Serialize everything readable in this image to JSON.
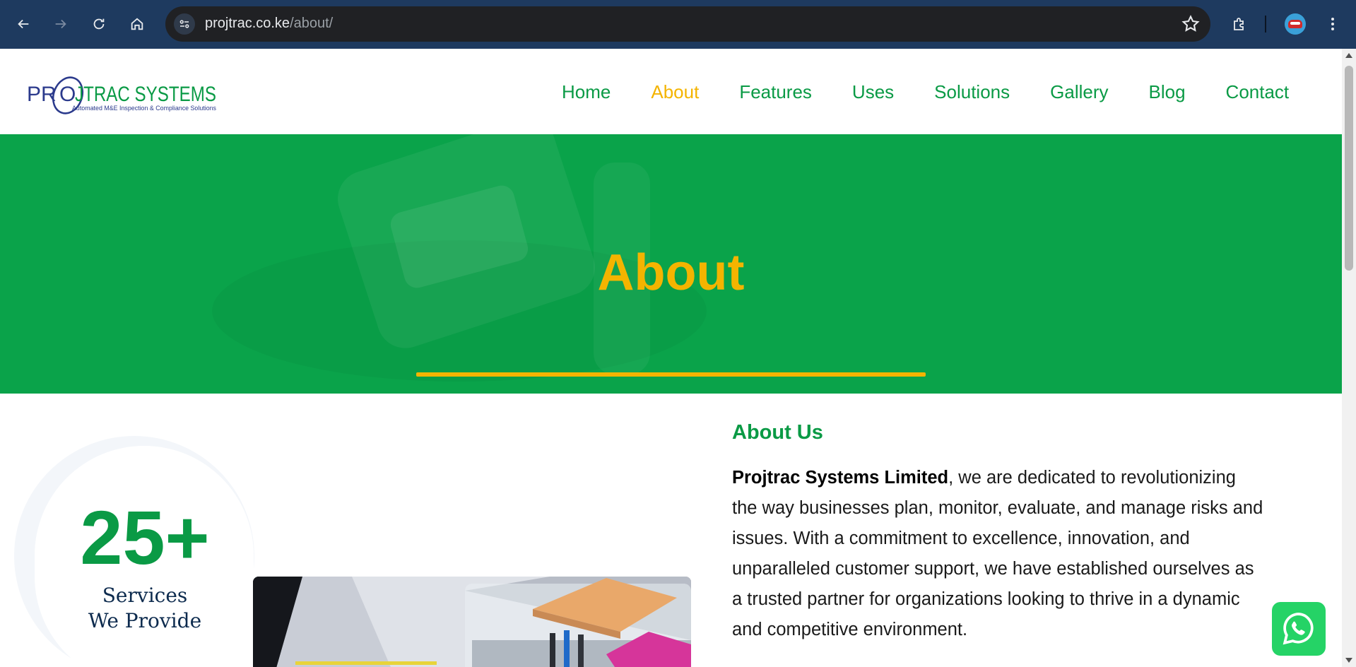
{
  "browser": {
    "url_host": "projtrac.co.ke",
    "url_path": "/about/",
    "icons": [
      "back-icon",
      "forward-icon",
      "reload-icon",
      "home-icon",
      "site-settings-icon",
      "bookmark-star-icon",
      "extensions-icon",
      "profile-avatar",
      "menu-dots-icon"
    ]
  },
  "header": {
    "logo": {
      "name": "PROJTRAC SYSTEMS",
      "tagline": "Automated M&E Inspection & Compliance Solutions"
    },
    "nav": [
      {
        "label": "Home"
      },
      {
        "label": "About",
        "active": true
      },
      {
        "label": "Features"
      },
      {
        "label": "Uses"
      },
      {
        "label": "Solutions"
      },
      {
        "label": "Gallery"
      },
      {
        "label": "Blog"
      },
      {
        "label": "Contact"
      }
    ]
  },
  "hero": {
    "title": "About"
  },
  "stats": {
    "value": "25+",
    "label_line1": "Services",
    "label_line2": "We Provide"
  },
  "about": {
    "heading": "About Us",
    "company": "Projtrac Systems Limited",
    "body": ", we are dedicated to revolutionizing the way businesses plan, monitor, evaluate, and manage risks and issues. With a commitment to excellence, innovation, and unparalleled customer support, we have established ourselves as a trusted partner for organizations looking to thrive in a dynamic and competitive environment."
  },
  "floating": {
    "whatsapp_icon": "whatsapp-icon"
  },
  "colors": {
    "brand_green": "#0aa34a",
    "accent_yellow": "#f4b400",
    "navy": "#0d2b4e",
    "chrome_bg": "#1e3a5f"
  }
}
